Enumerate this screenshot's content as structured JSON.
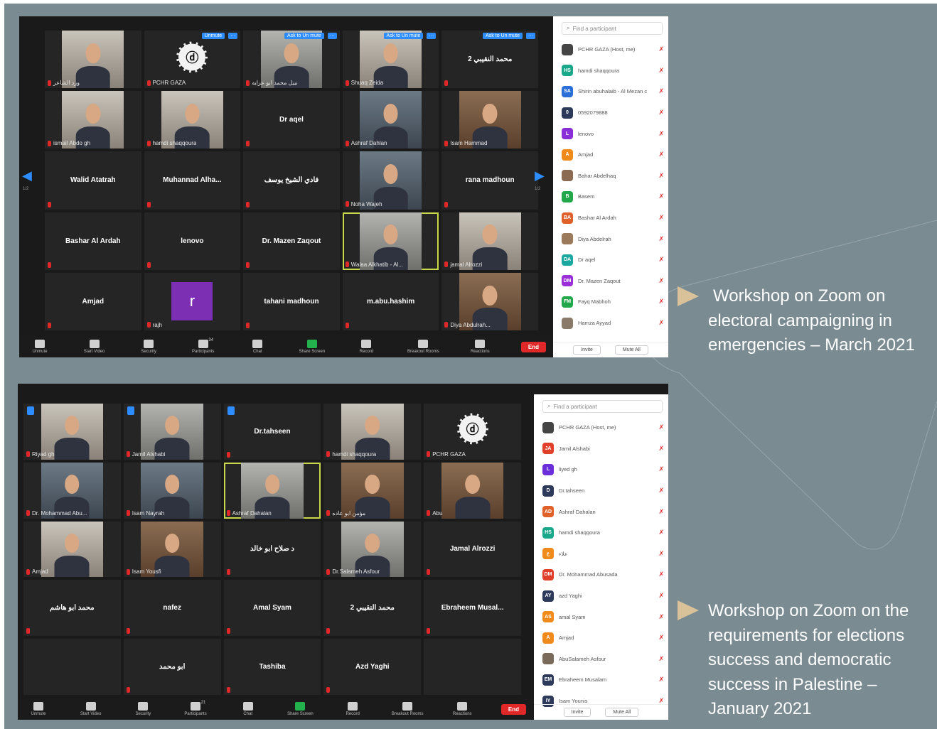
{
  "colors": {
    "background": "#7b8b92",
    "accent": "#2d8cff",
    "muted": "#e02828",
    "active_speaker": "#c7d84a",
    "caption_marker": "#d9c19a"
  },
  "screenshot1": {
    "tiles": [
      {
        "name": "",
        "label": "ورد الشاعر",
        "type": "video",
        "bg": "vbg2"
      },
      {
        "name": "",
        "label": "PCHR GAZA",
        "type": "logo",
        "chip": "Unmute"
      },
      {
        "name": "",
        "label": "نبيل محمد ابو عزايه",
        "type": "video",
        "bg": "vbg4",
        "chip": "Ask to Un mute"
      },
      {
        "name": "",
        "label": "Shuaq Zeida",
        "type": "video",
        "bg": "vbg2",
        "chip": "Ask to Un mute"
      },
      {
        "name": "محمد النقيبي 2",
        "label": "",
        "type": "name",
        "chip": "Ask to Un mute"
      },
      {
        "name": "",
        "label": "ismail Abdo gh",
        "type": "video",
        "bg": "vbg2"
      },
      {
        "name": "",
        "label": "hamdi shaqqoura",
        "type": "video",
        "bg": "vbg2"
      },
      {
        "name": "Dr aqel",
        "label": "",
        "type": "name"
      },
      {
        "name": "",
        "label": "Ashraf Dahlan",
        "type": "video",
        "bg": "vbg3"
      },
      {
        "name": "",
        "label": "Isam Hammad",
        "type": "video",
        "bg": "vbg1"
      },
      {
        "name": "Walid Atatrah",
        "label": "",
        "type": "name"
      },
      {
        "name": "Muhannad Alha...",
        "label": "",
        "type": "name"
      },
      {
        "name": "فادي الشيخ يوسف",
        "label": "",
        "type": "name"
      },
      {
        "name": "",
        "label": "Noha Wajeh",
        "type": "video",
        "bg": "vbg3"
      },
      {
        "name": "rana madhoun",
        "label": "",
        "type": "name"
      },
      {
        "name": "Bashar Al Ardah",
        "label": "",
        "type": "name"
      },
      {
        "name": "lenovo",
        "label": "",
        "type": "name"
      },
      {
        "name": "Dr. Mazen Zaqout",
        "label": "",
        "type": "name"
      },
      {
        "name": "",
        "label": "Walaa Alkhatib - Al...",
        "type": "video",
        "bg": "vbg4",
        "active": true
      },
      {
        "name": "",
        "label": "jamal Alrozzi",
        "type": "video",
        "bg": "vbg2"
      },
      {
        "name": "Amjad",
        "label": "",
        "type": "name"
      },
      {
        "name": "r",
        "label": "rajh",
        "type": "letter"
      },
      {
        "name": "tahani madhoun",
        "label": "",
        "type": "name"
      },
      {
        "name": "m.abu.hashim",
        "label": "",
        "type": "name"
      },
      {
        "name": "",
        "label": "Diya Abdulrah...",
        "type": "video",
        "bg": "vbg1"
      }
    ],
    "page_left": "1/2",
    "page_right": "1/2",
    "toolbar": [
      {
        "label": "Unmute"
      },
      {
        "label": "Start Video"
      },
      {
        "label": "Security"
      },
      {
        "label": "Participants"
      },
      {
        "label": "Chat"
      },
      {
        "label": "Share Screen"
      },
      {
        "label": "Record"
      },
      {
        "label": "Breakout Rooms"
      },
      {
        "label": "Reactions"
      }
    ],
    "participants_count": "34",
    "end_label": "End",
    "search_placeholder": "Find a participant",
    "participants": [
      {
        "initials": "",
        "name": "PCHR GAZA (Host, me)",
        "color": "#444444"
      },
      {
        "initials": "HS",
        "name": "hamdi shaqqoura",
        "color": "#1aa88a"
      },
      {
        "initials": "SA",
        "name": "Shirin abuhalaib - Al Mezan c",
        "color": "#2d6fd8"
      },
      {
        "initials": "0",
        "name": "0592079888",
        "color": "#2d3a5a"
      },
      {
        "initials": "L",
        "name": "lenovo",
        "color": "#8a2fd8"
      },
      {
        "initials": "A",
        "name": "Amjad",
        "color": "#f08a1a"
      },
      {
        "initials": "",
        "name": "Bahar Abdelhaq",
        "color": "#8a6a50"
      },
      {
        "initials": "B",
        "name": "Basem",
        "color": "#22a84a"
      },
      {
        "initials": "BA",
        "name": "Bashar Al Ardah",
        "color": "#e0602a"
      },
      {
        "initials": "",
        "name": "Diya Abdelrah",
        "color": "#9a7a5a"
      },
      {
        "initials": "DA",
        "name": "Dr aqel",
        "color": "#1aa8a0"
      },
      {
        "initials": "DM",
        "name": "Dr. Mazen Zaqout",
        "color": "#9a2fd8"
      },
      {
        "initials": "FM",
        "name": "Fayq Mabhoh",
        "color": "#22a84a"
      },
      {
        "initials": "",
        "name": "Hamza Ayyad",
        "color": "#8a7a6a"
      }
    ],
    "invite_label": "Invite",
    "muteall_label": "Mute All"
  },
  "screenshot2": {
    "tiles": [
      {
        "name": "",
        "label": "Riyad gh",
        "type": "video",
        "bg": "vbg2",
        "pin": true
      },
      {
        "name": "",
        "label": "Jamil Alshabi",
        "type": "video",
        "bg": "vbg4",
        "pin": true
      },
      {
        "name": "Dr.tahseen",
        "label": "",
        "type": "name",
        "pin": true
      },
      {
        "name": "",
        "label": "hamdi shaqqoura",
        "type": "video",
        "bg": "vbg2"
      },
      {
        "name": "",
        "label": "PCHR GAZA",
        "type": "logo"
      },
      {
        "name": "",
        "label": "Dr. Mohammad Abu...",
        "type": "video",
        "bg": "vbg3"
      },
      {
        "name": "",
        "label": "Isam Nayrah",
        "type": "video",
        "bg": "vbg3"
      },
      {
        "name": "",
        "label": "Ashraf Dahalan",
        "type": "video",
        "bg": "vbg4",
        "active": true
      },
      {
        "name": "",
        "label": "مؤمن ابو عاده",
        "type": "video",
        "bg": "vbg1"
      },
      {
        "name": "",
        "label": "Abu",
        "type": "video",
        "bg": "vbg1"
      },
      {
        "name": "",
        "label": "Amjad",
        "type": "video",
        "bg": "vbg2"
      },
      {
        "name": "",
        "label": "Isam Yousfi",
        "type": "video",
        "bg": "vbg1"
      },
      {
        "name": "د صلاح ابو خالد",
        "label": "",
        "type": "name"
      },
      {
        "name": "",
        "label": "Dr.Salameh Asfour",
        "type": "video",
        "bg": "vbg4"
      },
      {
        "name": "Jamal Alrozzi",
        "label": "",
        "type": "name"
      },
      {
        "name": "محمد ابو هاشم",
        "label": "",
        "type": "name"
      },
      {
        "name": "nafez",
        "label": "",
        "type": "name"
      },
      {
        "name": "Amal Syam",
        "label": "",
        "type": "name"
      },
      {
        "name": "محمد النقيبي 2",
        "label": "",
        "type": "name"
      },
      {
        "name": "Ebraheem Musal...",
        "label": "",
        "type": "name"
      },
      {
        "name": "",
        "label": "",
        "type": "empty"
      },
      {
        "name": "أبو محمد",
        "label": "",
        "type": "name"
      },
      {
        "name": "Tashiba",
        "label": "",
        "type": "name"
      },
      {
        "name": "Azd Yaghi",
        "label": "",
        "type": "name"
      },
      {
        "name": "",
        "label": "",
        "type": "empty"
      }
    ],
    "toolbar": [
      {
        "label": "Unmute"
      },
      {
        "label": "Start Video"
      },
      {
        "label": "Security"
      },
      {
        "label": "Participants"
      },
      {
        "label": "Chat"
      },
      {
        "label": "Share Screen"
      },
      {
        "label": "Record"
      },
      {
        "label": "Breakout Rooms"
      },
      {
        "label": "Reactions"
      }
    ],
    "participants_count": "21",
    "end_label": "End",
    "search_placeholder": "Find a participant",
    "participants": [
      {
        "initials": "",
        "name": "PCHR GAZA (Host, me)",
        "color": "#444444"
      },
      {
        "initials": "JA",
        "name": "Jamil Alshabi",
        "color": "#e0402a"
      },
      {
        "initials": "L",
        "name": "liyed gh",
        "color": "#6a2fd8"
      },
      {
        "initials": "D",
        "name": "Dr.tahseen",
        "color": "#2d3a5a"
      },
      {
        "initials": "AD",
        "name": "Ashraf Dahalan",
        "color": "#e0602a"
      },
      {
        "initials": "HS",
        "name": "hamdi shaqqoura",
        "color": "#1aa88a"
      },
      {
        "initials": "ع",
        "name": "علاء",
        "color": "#f08a1a"
      },
      {
        "initials": "DM",
        "name": "Dr. Mohammad Abusada",
        "color": "#e0402a"
      },
      {
        "initials": "AY",
        "name": "azd Yaghi",
        "color": "#2d3a5a"
      },
      {
        "initials": "AS",
        "name": "amal Syam",
        "color": "#f08a1a"
      },
      {
        "initials": "A",
        "name": "Amjad",
        "color": "#f08a1a"
      },
      {
        "initials": "",
        "name": "AbuSalameh Asfour",
        "color": "#7a6a5a"
      },
      {
        "initials": "EM",
        "name": "Ebraheem Musalam",
        "color": "#2d3a5a"
      },
      {
        "initials": "IY",
        "name": "Isam Younis",
        "color": "#2d3a5a"
      }
    ],
    "invite_label": "Invite",
    "muteall_label": "Mute All"
  },
  "captions": {
    "first": [
      "Workshop on Zoom on",
      "electoral campaigning in",
      "emergencies – March 2021"
    ],
    "second": [
      "Workshop on Zoom on the",
      "requirements for elections",
      "success and democratic",
      "success in Palestine –",
      "January 2021"
    ]
  }
}
